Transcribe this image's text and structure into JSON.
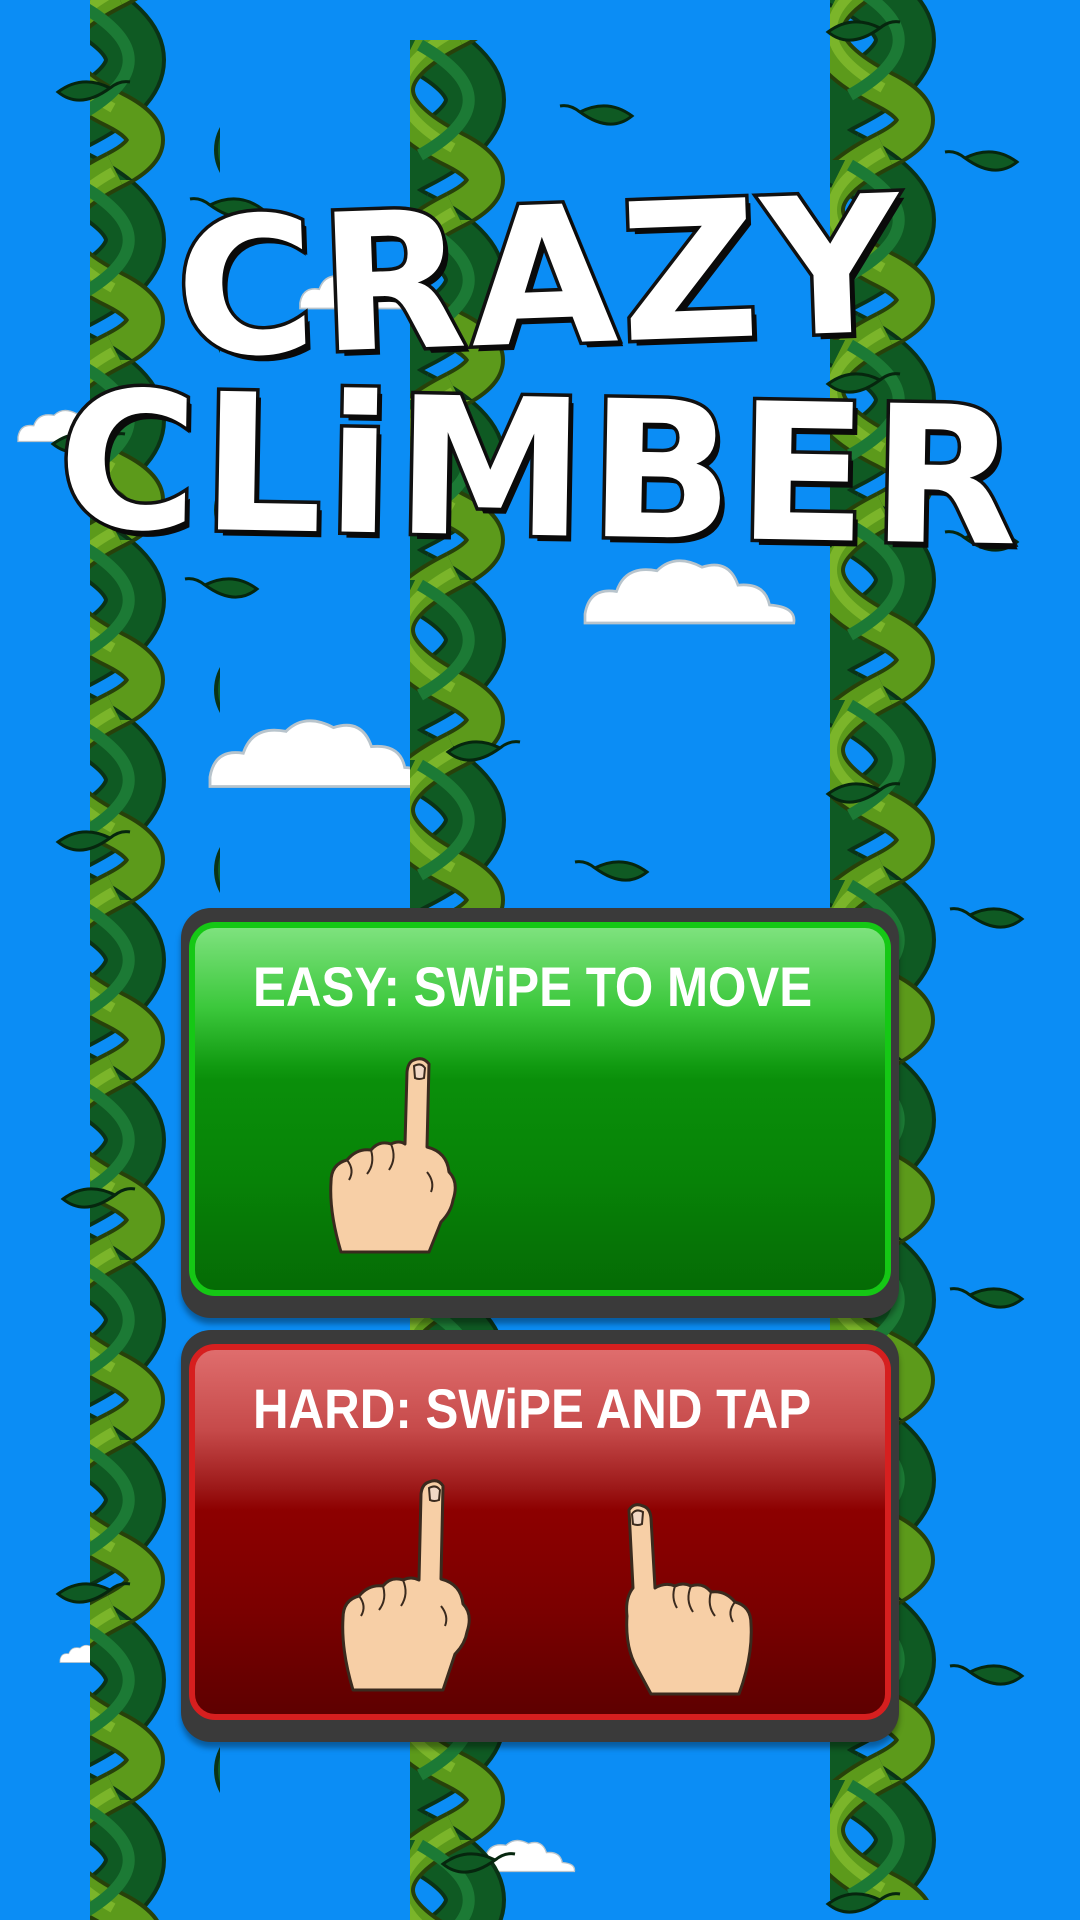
{
  "title": {
    "line1": "CRAZY",
    "line2": "CLiMBER"
  },
  "buttons": {
    "easy": {
      "label": "EASY: SWiPE TO MOVE",
      "color": "#0a8f0a"
    },
    "hard": {
      "label": "HARD: SWiPE AND TAP",
      "color": "#8d0000"
    }
  },
  "icons": {
    "easy": [
      "pointing-hand-icon"
    ],
    "hard": [
      "pointing-hand-icon",
      "pointing-hand-icon"
    ]
  },
  "colors": {
    "sky": "#0b8df5",
    "vine_dark": "#0f5a23",
    "vine_light": "#5c9a1b",
    "skin": "#f7cfa6"
  }
}
